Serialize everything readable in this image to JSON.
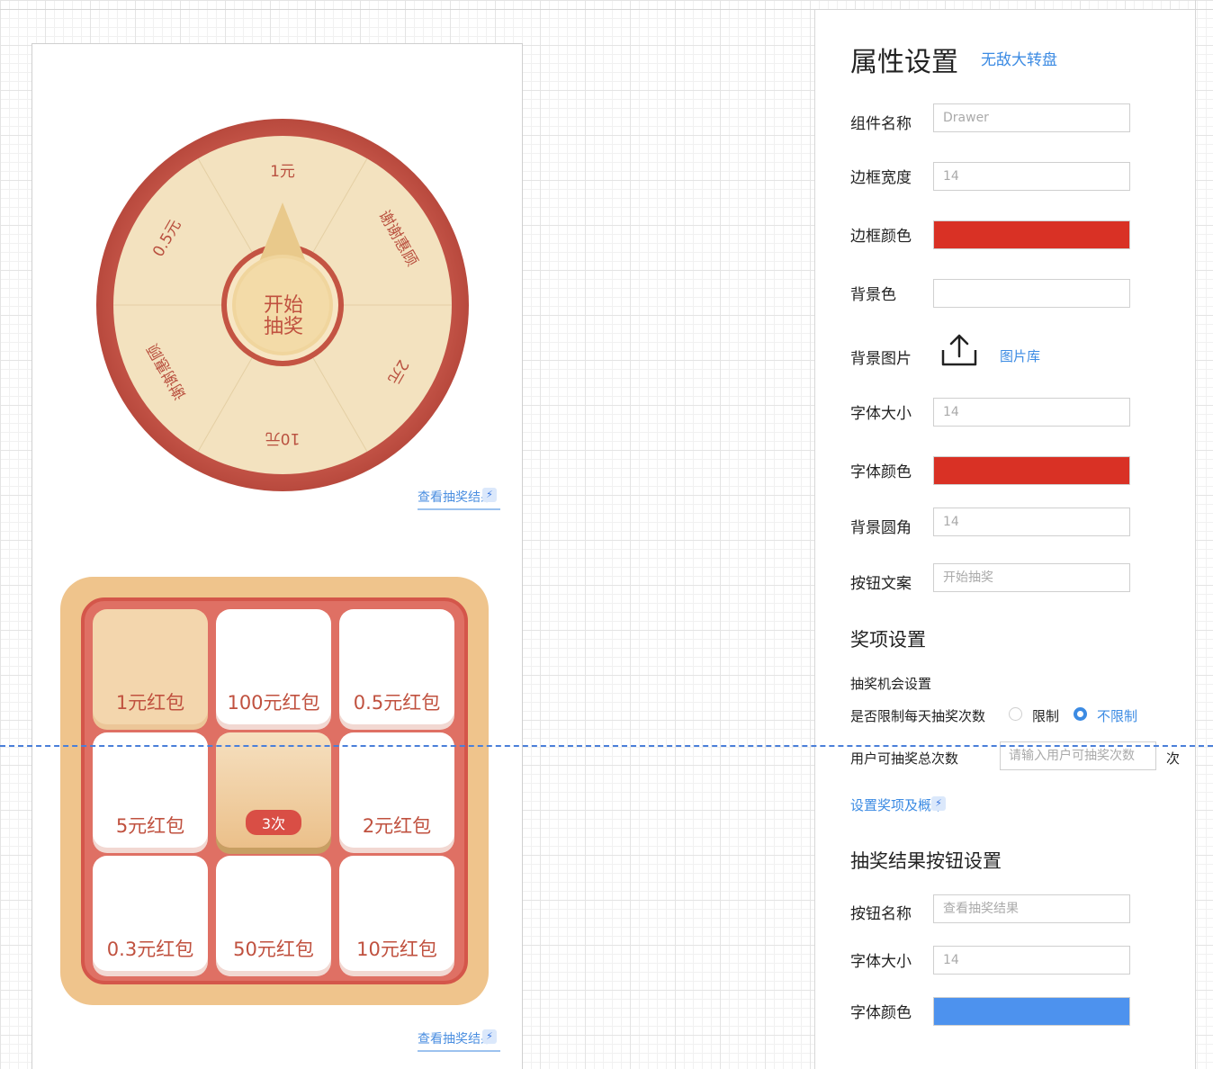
{
  "wheel": {
    "center_line1": "开始",
    "center_line2": "抽奖",
    "segments": [
      "1元",
      "谢谢惠顾",
      "2元",
      "10元",
      "谢谢惠顾",
      "0.5元"
    ],
    "result_link": "查看抽奖结果"
  },
  "grid": {
    "cells": [
      "1元红包",
      "100元红包",
      "0.5元红包",
      "5元红包",
      "2元红包",
      "0.3元红包",
      "50元红包",
      "10元红包"
    ],
    "center_badge": "3次",
    "result_link": "查看抽奖结果"
  },
  "panel": {
    "title": "属性设置",
    "subtitle": "无敌大转盘",
    "component_name_label": "组件名称",
    "component_name_placeholder": "Drawer",
    "border_width_label": "边框宽度",
    "border_width_placeholder": "14",
    "border_color_label": "边框颜色",
    "border_color": "#d93125",
    "bg_color_label": "背景色",
    "bg_color": "#ffffff",
    "bg_image_label": "背景图片",
    "image_library": "图片库",
    "font_size_label": "字体大小",
    "font_size_placeholder": "14",
    "font_color_label": "字体颜色",
    "font_color": "#d93125",
    "radius_label": "背景圆角",
    "radius_placeholder": "14",
    "button_text_label": "按钮文案",
    "button_text_placeholder": "开始抽奖",
    "prize_section": "奖项设置",
    "chance_setting": "抽奖机会设置",
    "limit_daily_label": "是否限制每天抽奖次数",
    "radio_limit": "限制",
    "radio_unlimited": "不限制",
    "total_times_label": "用户可抽奖总次数",
    "total_times_placeholder": "请输入用户可抽奖次数",
    "times_unit": "次",
    "prize_probability_link": "设置奖项及概率",
    "result_button_section": "抽奖结果按钮设置",
    "button_name_label": "按钮名称",
    "button_name_placeholder": "查看抽奖结果",
    "result_font_size_label": "字体大小",
    "result_font_size_placeholder": "14",
    "result_font_color_label": "字体颜色",
    "result_font_color": "#4d92ee"
  }
}
